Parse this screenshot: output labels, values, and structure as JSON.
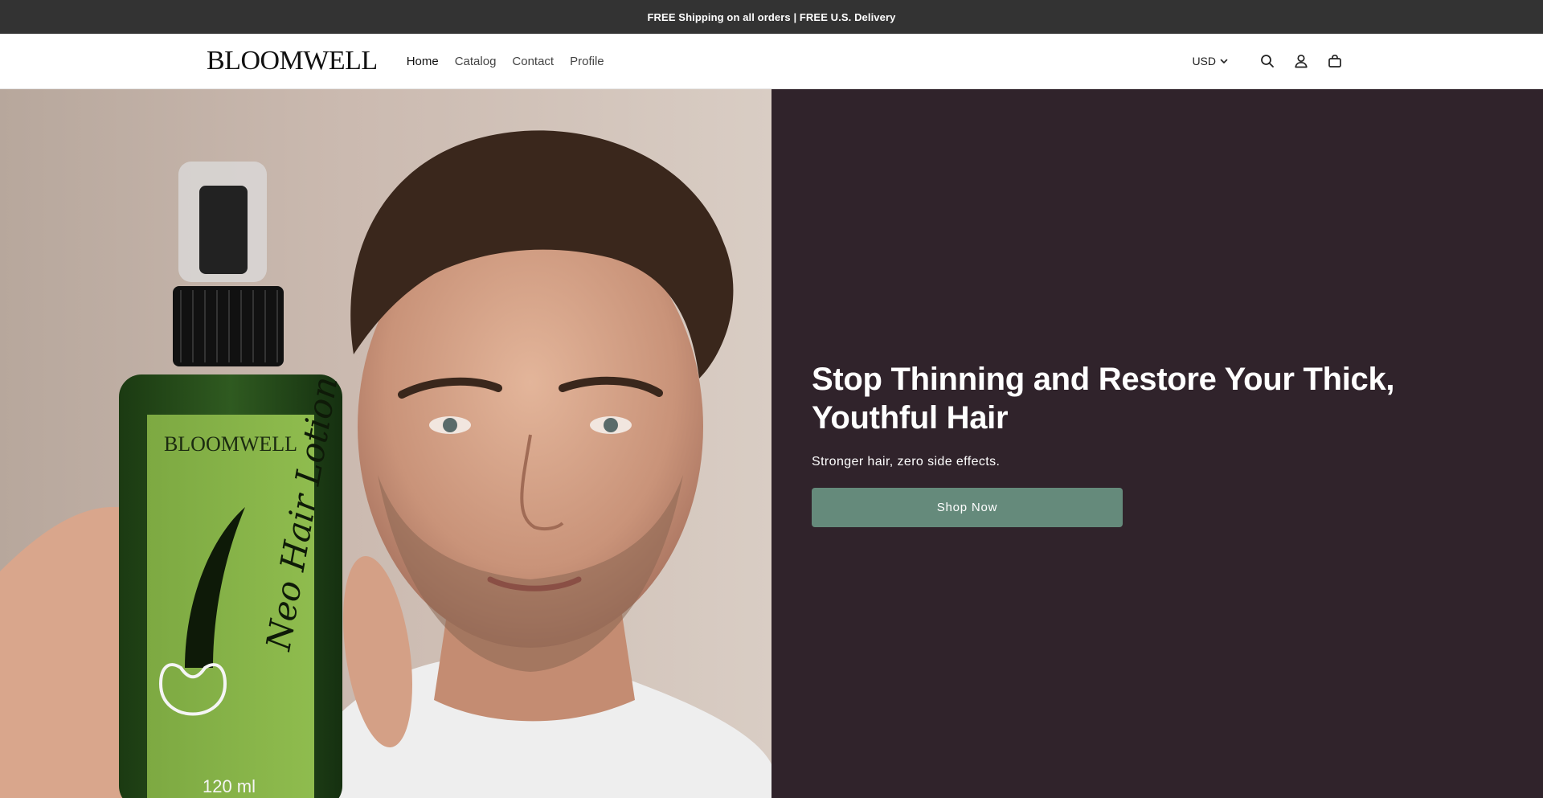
{
  "announcement": {
    "text": "FREE Shipping on all orders | FREE U.S. Delivery"
  },
  "header": {
    "logo": "BLOOMWELL",
    "nav": [
      {
        "label": "Home",
        "active": true
      },
      {
        "label": "Catalog",
        "active": false
      },
      {
        "label": "Contact",
        "active": false
      },
      {
        "label": "Profile",
        "active": false
      }
    ],
    "currency": "USD",
    "icons": [
      "search-icon",
      "account-icon",
      "cart-icon"
    ]
  },
  "hero": {
    "image": {
      "bottle_brand": "BLOOMWELL",
      "bottle_product": "Neo Hair Lotion",
      "bottle_volume": "120 ml"
    },
    "title": "Stop Thinning and Restore Your Thick, Youthful Hair",
    "subtitle": "Stronger hair, zero side effects.",
    "cta_label": "Shop Now"
  },
  "colors": {
    "announcement_bg": "#333333",
    "hero_panel_bg": "#30232b",
    "cta_bg": "#658a7b"
  }
}
